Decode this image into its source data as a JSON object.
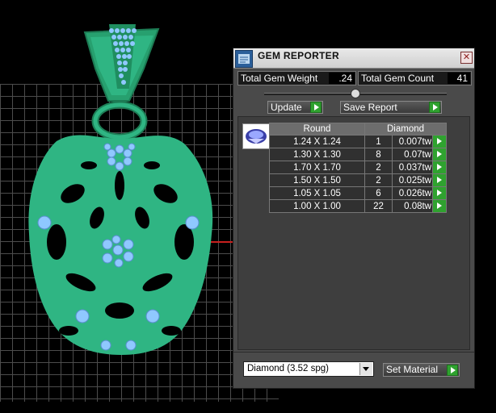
{
  "panel": {
    "title": "GEM REPORTER",
    "total_weight_label": "Total Gem Weight",
    "total_weight_value": ".24",
    "total_count_label": "Total Gem Count",
    "total_count_value": "41",
    "update_label": "Update",
    "save_label": "Save Report",
    "table": {
      "shape_header": "Round",
      "material_header": "Diamond",
      "rows": [
        {
          "size": "1.24 X 1.24",
          "count": "1",
          "weight": "0.007tw"
        },
        {
          "size": "1.30 X 1.30",
          "count": "8",
          "weight": "0.07tw"
        },
        {
          "size": "1.70 X 1.70",
          "count": "2",
          "weight": "0.037tw"
        },
        {
          "size": "1.50 X 1.50",
          "count": "2",
          "weight": "0.025tw"
        },
        {
          "size": "1.05 X 1.05",
          "count": "6",
          "weight": "0.026tw"
        },
        {
          "size": "1.00 X 1.00",
          "count": "22",
          "weight": "0.08tw"
        }
      ]
    },
    "material_select_value": "Diamond     (3.52 spg)",
    "set_material_label": "Set Material",
    "slider_level": 0.5
  },
  "colors": {
    "metal": "#2fb583",
    "gem": "#8fc8ff",
    "accent_green": "#2fa22f",
    "grid": "#5a5a5a"
  },
  "icons": [
    "close-icon",
    "gem-reporter-icon",
    "round-diamond-icon",
    "play-arrow-icon",
    "dropdown-arrow-icon"
  ]
}
